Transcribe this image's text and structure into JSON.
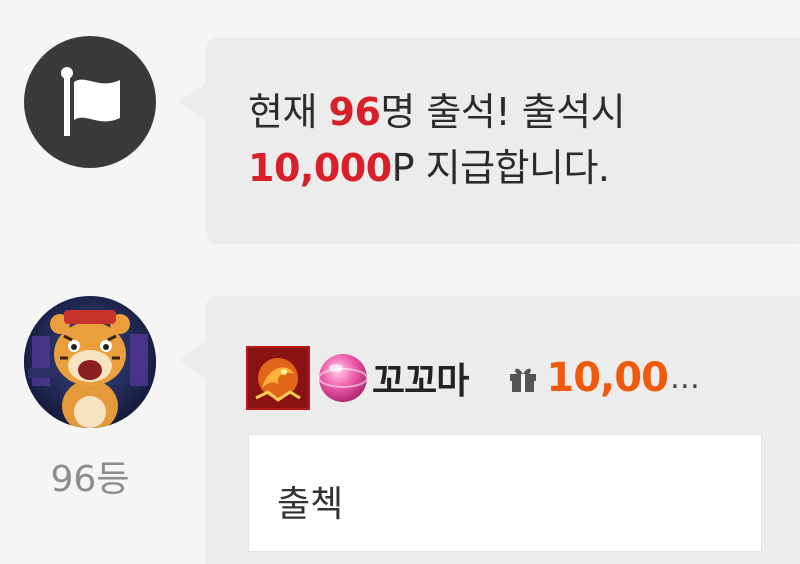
{
  "notice": {
    "icon": "flag-icon",
    "line1_prefix": "현재 ",
    "attendee_count": "96",
    "line1_suffix": "명 출석! 출석시",
    "reward_amount": "10,000",
    "line2_suffix": "P 지급합니다.",
    "highlight_color": "#d7202a"
  },
  "post": {
    "rank": "96등",
    "level_badge_icon": "dragon-badge-icon",
    "gem_icon": "pink-gem-icon",
    "nickname": "꼬꼬마",
    "gift_icon": "gift-icon",
    "points": "10,00",
    "points_ellipsis": "…",
    "points_color": "#f05a0a",
    "message": "출첵"
  }
}
